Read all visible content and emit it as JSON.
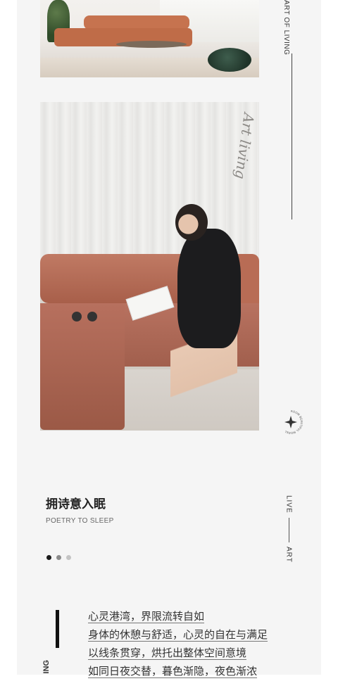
{
  "vertical_label": "ART OF LIVING",
  "script_text": "Art living",
  "badge": {
    "text": "ROOM BEAUTIFUL MODEL"
  },
  "section": {
    "title_cn": "拥诗意入眠",
    "title_en": "POETRY TO SLEEP"
  },
  "side_label": {
    "top": "LIVE",
    "bottom": "ART"
  },
  "carousel": {
    "dots": [
      {
        "active": true,
        "color": "#1a1a1a"
      },
      {
        "active": false,
        "color": "#8a8a8a"
      },
      {
        "active": false,
        "color": "#c4c4c4"
      }
    ]
  },
  "poem_side_label": "ING",
  "poem_lines": [
    "心灵港湾，界限流转自如",
    "身体的休憩与舒适，心灵的自在与满足",
    "以线条贯穿，烘托出整体空间意境",
    "如同日夜交替，暮色渐隐，夜色渐浓"
  ],
  "colors": {
    "background": "#f5f5f5",
    "sofa": "#b06a55",
    "text": "#222222"
  }
}
